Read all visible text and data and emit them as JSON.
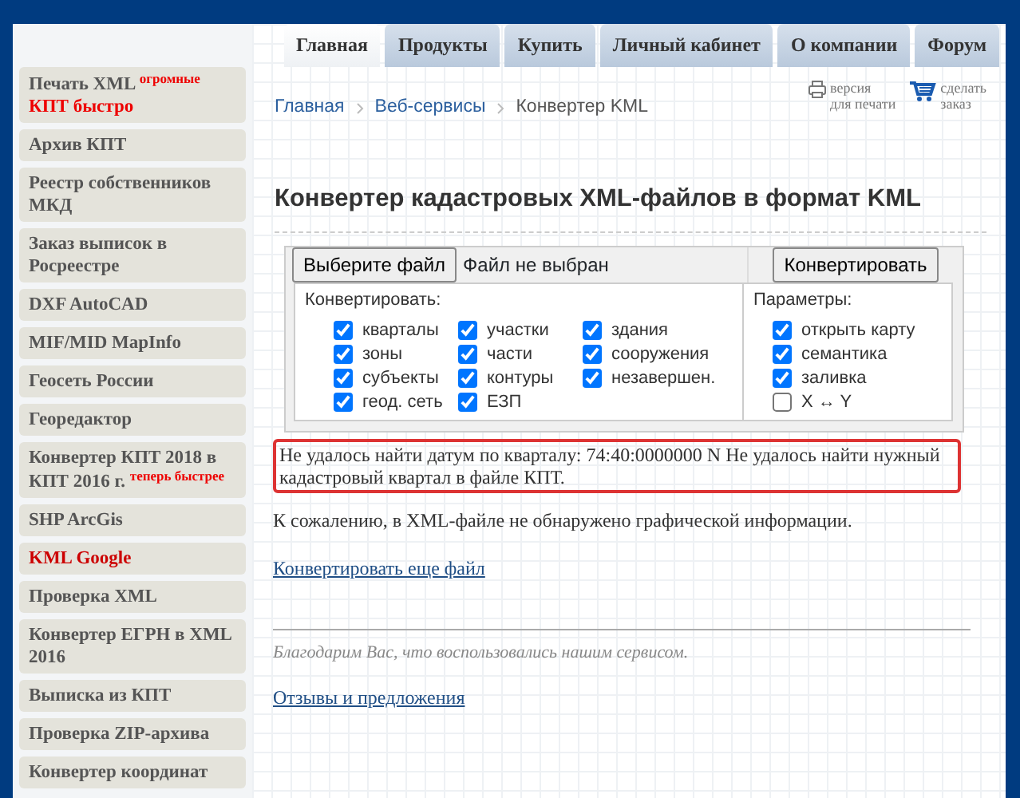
{
  "tabs": [
    {
      "label": "Главная",
      "selected": true
    },
    {
      "label": "Продукты",
      "selected": false
    },
    {
      "label": "Купить",
      "selected": false
    },
    {
      "label": "Личный кабинет",
      "selected": false
    },
    {
      "label": "О компании",
      "selected": false
    },
    {
      "label": "Форум",
      "selected": false
    }
  ],
  "sidebar": {
    "items": [
      {
        "label": "Печать XML",
        "note": "огромные",
        "label2": "КПТ быстро",
        "selected": false
      },
      {
        "label": "Архив КПТ",
        "selected": false
      },
      {
        "label": "Реестр собственников МКД",
        "selected": false
      },
      {
        "label": "Заказ выписок в Росреестре",
        "selected": false
      },
      {
        "label": "DXF AutoCAD",
        "selected": false
      },
      {
        "label": "MIF/MID MapInfo",
        "selected": false
      },
      {
        "label": "Геосеть России",
        "selected": false
      },
      {
        "label": "Георедактор",
        "selected": false
      },
      {
        "label": "Конвертер КПТ 2018 в КПТ 2016 г.",
        "note": "теперь быстрее",
        "selected": false
      },
      {
        "label": "SHP ArcGis",
        "selected": false
      },
      {
        "label": "KML Google",
        "selected": true
      },
      {
        "label": "Проверка XML",
        "selected": false
      },
      {
        "label": "Конвертер ЕГРН в XML 2016",
        "selected": false
      },
      {
        "label": "Выписка из КПТ",
        "selected": false
      },
      {
        "label": "Проверка ZIP-архива",
        "selected": false
      },
      {
        "label": "Конвертер координат",
        "selected": false
      }
    ]
  },
  "breadcrumb": [
    "Главная",
    "Веб-сервисы",
    "Конвертер KML"
  ],
  "tools": [
    {
      "kind": "print",
      "label": "версия",
      "label2": "для печати"
    },
    {
      "kind": "cart",
      "label": "сделать",
      "label2": "заказ"
    }
  ],
  "title": "Конвертер кадастровых XML-файлов в формат KML",
  "form": {
    "file_button": "Выберите файл",
    "file_status": "Файл не выбран",
    "convert_button": "Конвертировать",
    "convert_label": "Конвертировать:",
    "convert_columns": [
      [
        {
          "label": "кварталы",
          "checked": true
        },
        {
          "label": "зоны",
          "checked": true
        },
        {
          "label": "субъекты",
          "checked": true
        },
        {
          "label": "геод. сеть",
          "checked": true
        }
      ],
      [
        {
          "label": "участки",
          "checked": true
        },
        {
          "label": "части",
          "checked": true
        },
        {
          "label": "контуры",
          "checked": true
        },
        {
          "label": "ЕЗП",
          "checked": true
        }
      ],
      [
        {
          "label": "здания",
          "checked": true
        },
        {
          "label": "сооружения",
          "checked": true
        },
        {
          "label": "незавершен.",
          "checked": true
        }
      ]
    ],
    "params_label": "Параметры:",
    "params": [
      {
        "label": "открыть карту",
        "checked": true
      },
      {
        "label": "семантика",
        "checked": true
      },
      {
        "label": "заливка",
        "checked": true
      },
      {
        "label": "X ↔ Y",
        "checked": false
      }
    ]
  },
  "error": "Не удалось найти датум по кварталу: 74:40:0000000 N Не удалось найти нужный кадастровый квартал в файле КПТ.",
  "message": "К сожалению, в XML-файле не обнаружено графической информации.",
  "again_link": "Конвертировать еще файл",
  "thanks": "Благодарим Вас, что воспользовались нашим сервисом.",
  "feedback_link": "Отзывы и предложения"
}
